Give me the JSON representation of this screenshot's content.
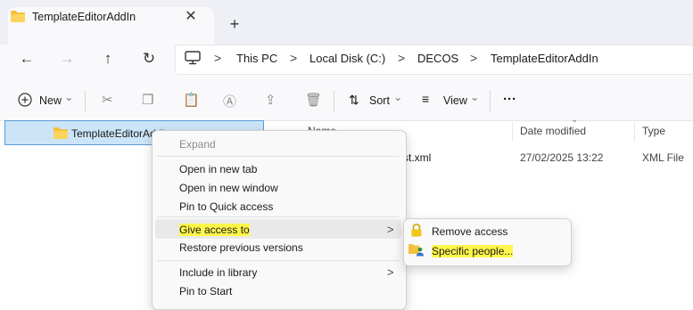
{
  "window": {
    "tab_title": "TemplateEditorAddIn",
    "close_tab_glyph": "✕",
    "new_tab_glyph": "+"
  },
  "nav": {
    "back_glyph": "←",
    "forward_glyph": "→",
    "up_glyph": "↑",
    "refresh_glyph": "↻",
    "breadcrumbs": [
      "This PC",
      "Local Disk (C:)",
      "DECOS",
      "TemplateEditorAddIn"
    ],
    "separator": ">"
  },
  "commandbar": {
    "new_label": "New",
    "sort_label": "Sort",
    "view_label": "View",
    "more_label": "···",
    "caret": "⌄"
  },
  "left_pane": {
    "selected_item": "TemplateEditorAddIn"
  },
  "file_list": {
    "columns": [
      "Name",
      "Date modified",
      "Type"
    ],
    "rows": [
      {
        "name": "fest.xml",
        "date": "27/02/2025 13:22",
        "type": "XML File"
      }
    ]
  },
  "context_menu": {
    "expand": "Expand",
    "open_new_tab": "Open in new tab",
    "open_new_window": "Open in new window",
    "pin_quick_access": "Pin to Quick access",
    "give_access": "Give access to",
    "restore_versions": "Restore previous versions",
    "include_library": "Include in library",
    "pin_start": "Pin to Start",
    "chevron": ">"
  },
  "submenu": {
    "remove_access": "Remove access",
    "specific_people": "Specific people..."
  },
  "colors": {
    "highlight": "#fff64a",
    "selection": "#cce4f7",
    "folder": "#f4c13f"
  }
}
